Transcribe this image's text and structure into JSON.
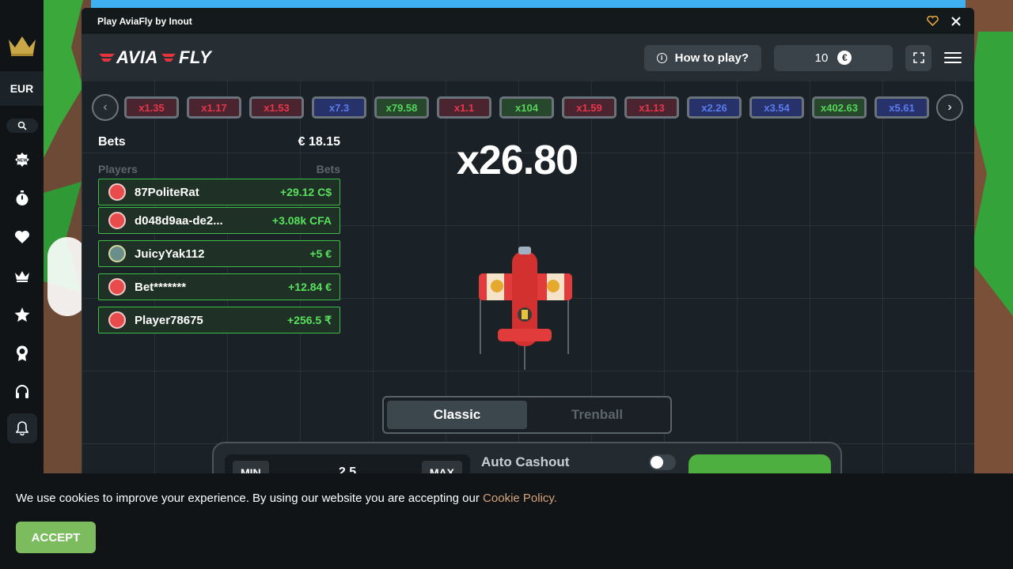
{
  "sidebar": {
    "currency": "EUR",
    "icons": [
      "crown-logo-icon",
      "search-icon",
      "new-badge-icon",
      "stopwatch-icon",
      "heart-icon",
      "crown-icon",
      "star-icon",
      "award-icon",
      "headset-icon",
      "bell-icon"
    ]
  },
  "window": {
    "title": "Play AviaFly by Inout"
  },
  "header": {
    "logo_part1": "AVIA",
    "logo_part2": "FLY",
    "how_to_play": "How to play?",
    "balance": "10",
    "currency_symbol": "€"
  },
  "history": [
    {
      "value": "x1.35",
      "color": "red"
    },
    {
      "value": "x1.17",
      "color": "red"
    },
    {
      "value": "x1.53",
      "color": "red"
    },
    {
      "value": "x7.3",
      "color": "blue"
    },
    {
      "value": "x79.58",
      "color": "green"
    },
    {
      "value": "x1.1",
      "color": "red"
    },
    {
      "value": "x104",
      "color": "green"
    },
    {
      "value": "x1.59",
      "color": "red"
    },
    {
      "value": "x1.13",
      "color": "red"
    },
    {
      "value": "x2.26",
      "color": "blue"
    },
    {
      "value": "x3.54",
      "color": "blue"
    },
    {
      "value": "x402.63",
      "color": "green"
    },
    {
      "value": "x5.61",
      "color": "blue"
    }
  ],
  "bets": {
    "title": "Bets",
    "total": "€ 18.15",
    "col_players": "Players",
    "col_bets": "Bets",
    "rows": [
      {
        "name": "87PoliteRat",
        "win": "+29.12 C$"
      },
      {
        "name": "d048d9aa-de2...",
        "win": "+3.08k CFA"
      },
      {
        "name": "JuicyYak112",
        "win": "+5 €"
      },
      {
        "name": "Bet*******",
        "win": "+12.84 €"
      },
      {
        "name": "Player78675",
        "win": "+256.5 ₹"
      }
    ]
  },
  "game": {
    "multiplier": "x26.80",
    "mode_classic": "Classic",
    "mode_trenball": "Trenball",
    "min_label": "MIN",
    "max_label": "MAX",
    "bet_amount": "2.5",
    "auto_cashout": "Auto Cashout",
    "auto_cashout_enabled": false
  },
  "cookie": {
    "message": "We use cookies to improve your experience. By using our website you are accepting our",
    "link": "Cookie Policy.",
    "accept": "ACCEPT"
  },
  "colors": {
    "win_green": "#59e05d",
    "accent_red": "#e8343c",
    "accept_green": "#7dbb5f"
  }
}
